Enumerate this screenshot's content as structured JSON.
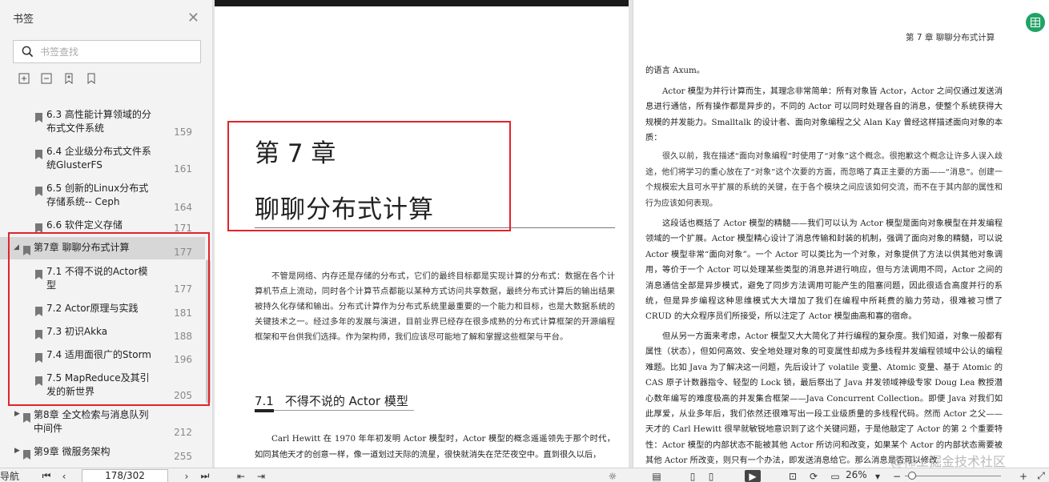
{
  "sidebar": {
    "title": "书签",
    "search_placeholder": "书签查找",
    "items": [
      {
        "label": "6.3 高性能计算领域的分",
        "label2": "布式文件系统",
        "page": "159"
      },
      {
        "label": "6.4 企业级分布式文件系",
        "label2": "统GlusterFS",
        "page": "161"
      },
      {
        "label": "6.5 创新的Linux分布式",
        "label2": "存储系统-- Ceph",
        "page": "164"
      },
      {
        "label": "6.6 软件定义存储",
        "label2": "",
        "page": "171"
      },
      {
        "label": "第7章 聊聊分布式计算",
        "label2": "",
        "page": "177"
      },
      {
        "label": "7.1 不得不说的Actor模",
        "label2": "型",
        "page": "177"
      },
      {
        "label": "7.2 Actor原理与实践",
        "label2": "",
        "page": "181"
      },
      {
        "label": "7.3 初识Akka",
        "label2": "",
        "page": "188"
      },
      {
        "label": "7.4 适用面很广的Storm",
        "label2": "",
        "page": "196"
      },
      {
        "label": "7.5 MapReduce及其引",
        "label2": "发的新世界",
        "page": "205"
      },
      {
        "label": "第8章 全文检索与消息队列",
        "label2": "中间件",
        "page": "212"
      },
      {
        "label": "第9章 微服务架构",
        "label2": "",
        "page": "255"
      }
    ]
  },
  "left_page": {
    "chapter_num": "第 7 章",
    "chapter_title": "聊聊分布式计算",
    "intro": "不管是网络、内存还是存储的分布式，它们的最终目标都是实现计算的分布式：数据在各个计算机节点上流动，同时各个计算节点都能以某种方式访问共享数据，最终分布式计算后的输出结果被持久化存储和输出。分布式计算作为分布式系统里最重要的一个能力和目标，也是大数据系统的关键技术之一。经过多年的发展与演进，目前业界已经存在很多成熟的分布式计算框架的开源编程框架和平台供我们选择。作为架构师，我们应该尽可能地了解和掌握这些框架与平台。",
    "section_num": "7.1",
    "section_title": "不得不说的 Actor 模型",
    "body": "Carl Hewitt 在 1970 年年初发明 Actor 模型时，Actor 模型的概念遥遥领先于那个时代，如同其他天才的创意一样，像一道划过天际的流星，很快就消失在茫茫夜空中。直到很久以后，"
  },
  "right_page": {
    "header": "第 7 章  聊聊分布式计算",
    "p0": "的语言 Axum。",
    "p1": "Actor 模型为并行计算而生，其理念非常简单：所有对象皆 Actor，Actor 之间仅通过发送消息进行通信，所有操作都是异步的，不同的 Actor 可以同时处理各自的消息，使整个系统获得大规模的并发能力。Smalltalk 的设计者、面向对象编程之父 Alan Kay 曾经这样描述面向对象的本质：",
    "quote": "很久以前，我在描述“面向对象编程”时使用了“对象”这个概念。很抱歉这个概念让许多人误入歧途，他们将学习的重心放在了“对象”这个次要的方面，而忽略了真正主要的方面——“消息”。创建一个规模宏大且可水平扩展的系统的关键，在于各个模块之间应该如何交流，而不在于其内部的属性和行为应该如何表现。",
    "p2": "这段话也概括了 Actor 模型的精髓——我们可以认为 Actor 模型是面向对象模型在并发编程领域的一个扩展。Actor 模型精心设计了消息传输和封装的机制，强调了面向对象的精髓，可以说 Actor 模型非常“面向对象”。一个 Actor 可以类比为一个对象，对象提供了方法以供其他对象调用，等价于一个 Actor 可以处理某些类型的消息并进行响应，但与方法调用不同，Actor 之间的消息通信全部是异步模式，避免了同步方法调用可能产生的阻塞问题，因此很适合高度并行的系统，但是异步编程这种思维模式大大增加了我们在编程中所耗费的脑力劳动，很难被习惯了 CRUD 的大众程序员们所接受，所以注定了 Actor 模型曲高和寡的宿命。",
    "p3": "但从另一方面来考虑，Actor 模型又大大简化了并行编程的复杂度。我们知道，对象一般都有属性（状态），但如何高效、安全地处理对象的可变属性却成为多线程并发编程领域中公认的编程难题。比如 Java 为了解决这一问题，先后设计了 volatile 变量、Atomic 变量、基于 Atomic 的 CAS 原子计数器指令、轻型的 Lock 锁，最后祭出了 Java 并发领域神级专家 Doug Lea 教授潜心数年编写的难度极高的并发集合框架——Java Concurrent Collection。即便 Java 对我们如此厚爱，从业多年后，我们依然还很难写出一段工业级质量的多线程代码。然而 Actor 之父——天才的 Carl Hewitt 很早就敏锐地意识到了这个关键问题，于是他敲定了 Actor 的第 2 个重要特性：Actor 模型的内部状态不能被其他 Actor 所访问和改变，如果某个 Actor 的内部状态需要被其他 Actor 所改变，则只有一个办法，即发送消息给它。那么消息是否可以修改"
  },
  "statusbar": {
    "left_label": "导航",
    "page_indicator": "178/302",
    "zoom": "26%"
  },
  "watermark": "@稀土掘金技术社区",
  "colors": {
    "accent_red": "#e0242a",
    "fab_green": "#21a366"
  }
}
